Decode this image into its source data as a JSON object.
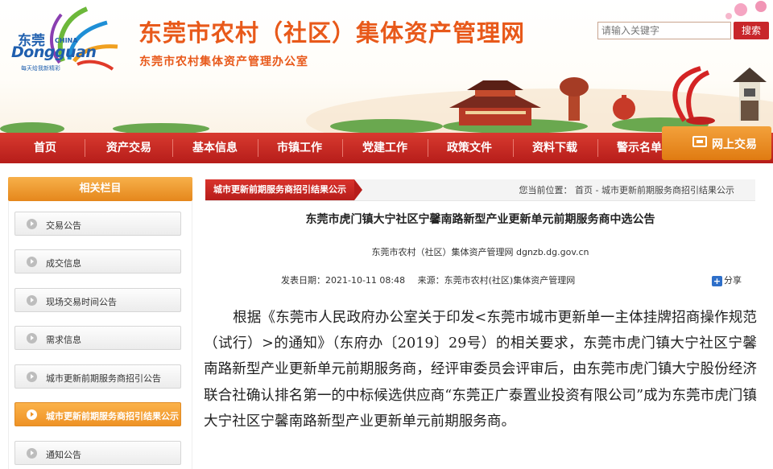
{
  "header": {
    "logo": {
      "cn": "东莞",
      "china": "CHINA",
      "en": "Dongguan",
      "slogan": "每天给我新精彩"
    },
    "title": "东莞市农村（社区）集体资产管理网",
    "subtitle": "东莞市农村集体资产管理办公室",
    "search": {
      "placeholder": "请输入关键字",
      "button": "搜索"
    }
  },
  "nav": {
    "items": [
      "首页",
      "资产交易",
      "基本信息",
      "市镇工作",
      "党建工作",
      "政策文件",
      "资料下载",
      "警示名单"
    ],
    "online": "网上交易"
  },
  "sidebar": {
    "heading": "相关栏目",
    "items": [
      {
        "label": "交易公告",
        "active": false
      },
      {
        "label": "成交信息",
        "active": false
      },
      {
        "label": "现场交易时间公告",
        "active": false
      },
      {
        "label": "需求信息",
        "active": false
      },
      {
        "label": "城市更新前期服务商招引公告",
        "active": false
      },
      {
        "label": "城市更新前期服务商招引结果公示",
        "active": true
      },
      {
        "label": "通知公告",
        "active": false
      }
    ]
  },
  "content": {
    "tab": "城市更新前期服务商招引结果公示",
    "breadcrumb": "您当前位置：  首页 - 城市更新前期服务商招引结果公示",
    "title": "东莞市虎门镇大宁社区宁馨南路新型产业更新单元前期服务商中选公告",
    "source_line": "东莞市农村（社区）集体资产管理网    dgnzb.dg.gov.cn",
    "publish_date": "发表日期：2021-10-11 08:48",
    "source": "来源：东莞市农村(社区)集体资产管理网",
    "share": "分享",
    "body": "根据《东莞市人民政府办公室关于印发<东莞市城市更新单一主体挂牌招商操作规范（试行）>的通知》（东府办〔2019〕29号）的相关要求，东莞市虎门镇大宁社区宁馨南路新型产业更新单元前期服务商，经评审委员会评审后，由东莞市虎门镇大宁股份经济联合社确认排名第一的中标候选供应商“东莞正广泰置业投资有限公司”成为东莞市虎门镇大宁社区宁馨南路新型产业更新单元前期服务商。"
  },
  "colors": {
    "brand_orange": "#e8591a",
    "nav_red": "#c8262a",
    "accent_orange": "#ee9225"
  }
}
